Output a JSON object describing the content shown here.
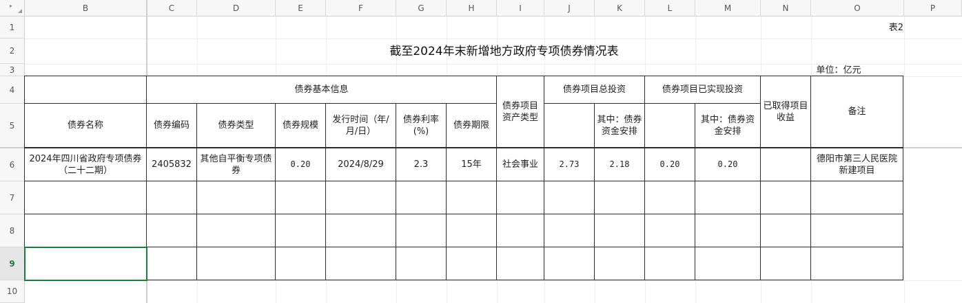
{
  "columns": [
    "B",
    "C",
    "D",
    "E",
    "F",
    "G",
    "H",
    "I",
    "J",
    "K",
    "L",
    "M",
    "N",
    "O",
    "P"
  ],
  "rows": [
    "1",
    "2",
    "3",
    "4",
    "5",
    "6",
    "7",
    "8",
    "9",
    "10"
  ],
  "table_no": "表2",
  "title": "截至2024年末新增地方政府专项债券情况表",
  "unit": "单位：亿元",
  "headers": {
    "basic_info": "债券基本信息",
    "asset_type": "债券项目资产类型",
    "total_investment": "债券项目总投资",
    "realized_investment": "债券项目已实现投资",
    "income": "已取得项目收益",
    "remarks": "备注",
    "name": "债券名称",
    "code": "债券编码",
    "type": "债券类型",
    "scale": "债券规模",
    "issue_date": "发行时间（年/月/日）",
    "rate": "债券利率(%)",
    "term": "债券期限",
    "total_bond_part": "其中：债券资金安排",
    "realized_bond_part": "其中：债券资金安排"
  },
  "data_row": {
    "name": "2024年四川省政府专项债券（二十二期）",
    "code": "2405832",
    "type": "其他自平衡专项债券",
    "scale": "0.20",
    "issue_date": "2024/8/29",
    "rate": "2.3",
    "term": "15年",
    "asset_type": "社会事业",
    "total_investment": "2.73",
    "total_bond_part": "2.18",
    "realized_investment": "0.20",
    "realized_bond_part": "0.20",
    "income": "",
    "remarks": "德阳市第三人民医院新建项目"
  }
}
